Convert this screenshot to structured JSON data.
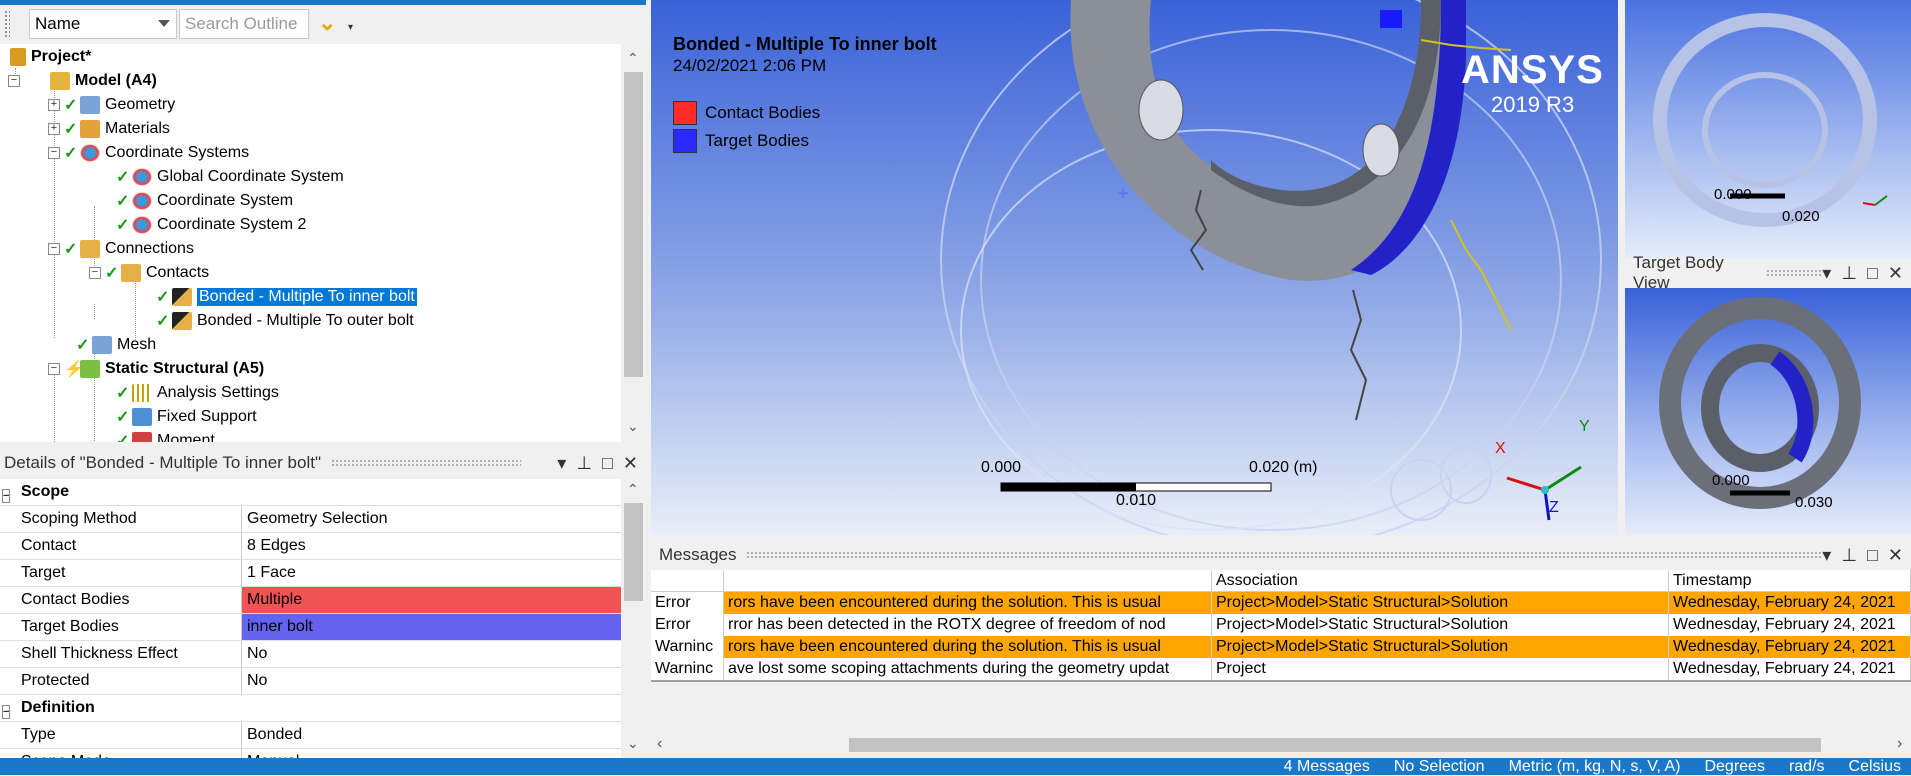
{
  "outline": {
    "name_filter": "Name",
    "search_placeholder": "Search Outline",
    "tree": [
      {
        "label": "Project*"
      },
      {
        "label": "Model (A4)"
      },
      {
        "label": "Geometry"
      },
      {
        "label": "Materials"
      },
      {
        "label": "Coordinate Systems"
      },
      {
        "label": "Global Coordinate System"
      },
      {
        "label": "Coordinate System"
      },
      {
        "label": "Coordinate System 2"
      },
      {
        "label": "Connections"
      },
      {
        "label": "Contacts"
      },
      {
        "label": "Bonded - Multiple To inner bolt"
      },
      {
        "label": "Bonded - Multiple To outer bolt"
      },
      {
        "label": "Mesh"
      },
      {
        "label": "Static Structural (A5)"
      },
      {
        "label": "Analysis Settings"
      },
      {
        "label": "Fixed Support"
      },
      {
        "label": "Moment"
      }
    ]
  },
  "details": {
    "title": "Details of \"Bonded - Multiple To inner bolt\"",
    "sections": [
      {
        "label": "Scope"
      },
      {
        "label": "Definition"
      }
    ],
    "rows": [
      {
        "key": "Scoping Method",
        "value": "Geometry Selection"
      },
      {
        "key": "Contact",
        "value": "8 Edges"
      },
      {
        "key": "Target",
        "value": "1 Face"
      },
      {
        "key": "Contact Bodies",
        "value": "Multiple"
      },
      {
        "key": "Target Bodies",
        "value": "inner bolt"
      },
      {
        "key": "Shell Thickness Effect",
        "value": "No"
      },
      {
        "key": "Protected",
        "value": "No"
      },
      {
        "key": "Type",
        "value": "Bonded"
      },
      {
        "key": "Scope Mode",
        "value": "Manual"
      }
    ],
    "colors": {
      "contact": "#f15252",
      "target": "#6363f0"
    }
  },
  "viewport": {
    "title": "Bonded - Multiple To inner bolt",
    "date": "24/02/2021 2:06 PM",
    "legend": [
      {
        "label": "Contact Bodies",
        "color": "#ff2a2a"
      },
      {
        "label": "Target Bodies",
        "color": "#2a2aff"
      }
    ],
    "brand": "ANSYS",
    "version": "2019 R3",
    "scale_left": "0.000",
    "scale_right": "0.020 (m)",
    "scale_mid": "0.010",
    "axis_x": "X",
    "axis_y": "Y",
    "axis_z": "Z"
  },
  "contact_view": {
    "scale_left": "0.000",
    "scale_mid": "0.020"
  },
  "target_view": {
    "title": "Target Body View",
    "scale_left": "0.000",
    "scale_mid": "0.030"
  },
  "messages": {
    "title": "Messages",
    "columns": [
      "",
      "Association",
      "Timestamp"
    ],
    "rows": [
      {
        "type": "Error",
        "text": "rors have been encountered during the solution.  This is usual",
        "assoc": "Project>Model>Static Structural>Solution",
        "time": "Wednesday, February 24, 2021",
        "highlight": true
      },
      {
        "type": "Error",
        "text": "rror has been detected in the ROTX degree of freedom of nod",
        "assoc": "Project>Model>Static Structural>Solution",
        "time": "Wednesday, February 24, 2021",
        "highlight": false
      },
      {
        "type": "Warninc",
        "text": "rors have been encountered during the solution.  This is usual",
        "assoc": "Project>Model>Static Structural>Solution",
        "time": "Wednesday, February 24, 2021",
        "highlight": true
      },
      {
        "type": "Warninc",
        "text": "ave lost some scoping attachments during the geometry updat",
        "assoc": "Project",
        "time": "Wednesday, February 24, 2021",
        "highlight": false
      }
    ]
  },
  "status": {
    "messages": "4 Messages",
    "selection": "No Selection",
    "units": "Metric (m, kg, N, s, V, A)",
    "angle": "Degrees",
    "angular_vel": "rad/s",
    "temp": "Celsius"
  }
}
